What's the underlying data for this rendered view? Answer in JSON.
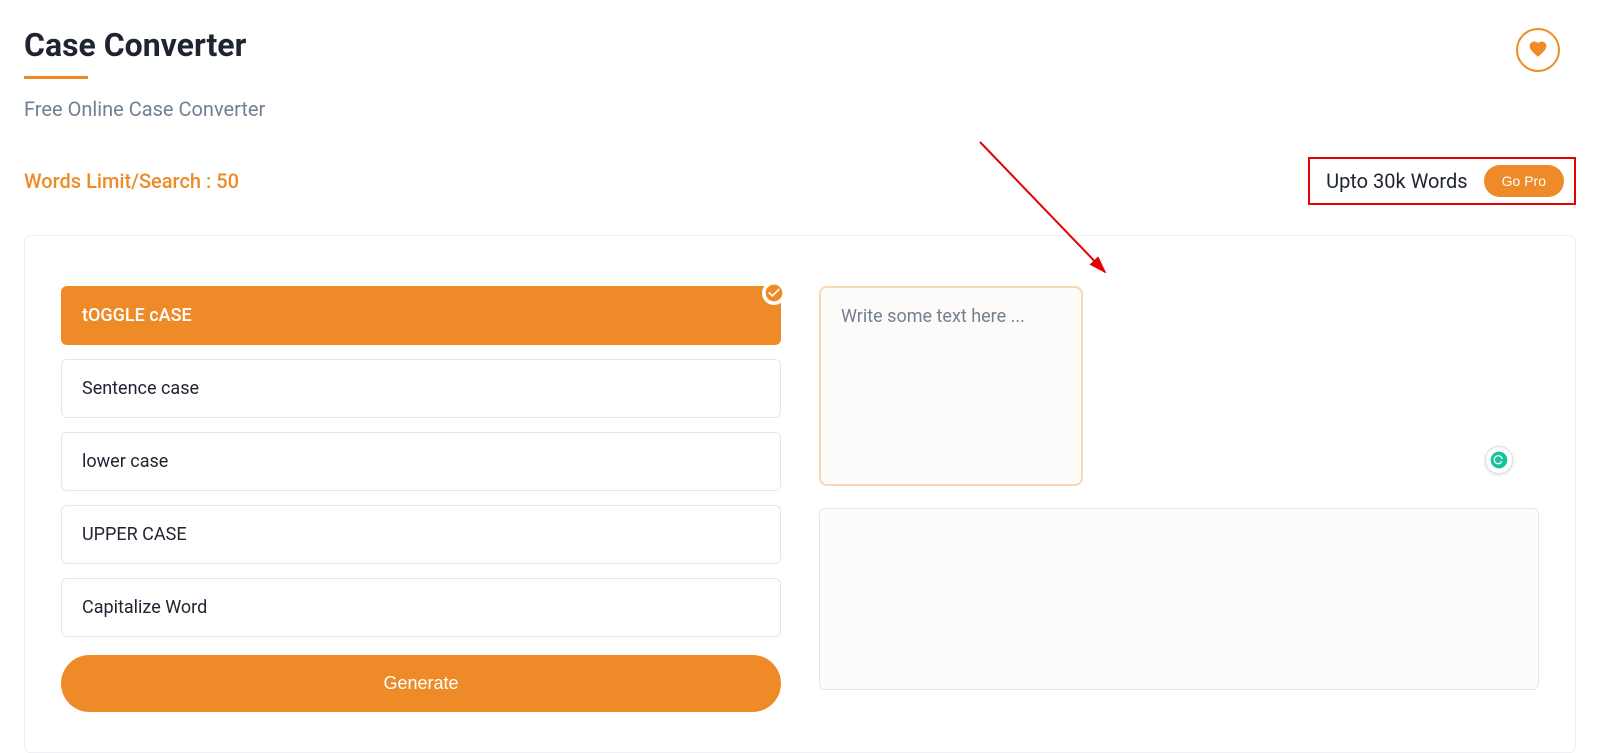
{
  "header": {
    "title": "Case Converter",
    "subtitle": "Free Online Case Converter"
  },
  "limit": {
    "label": "Words Limit/Search : 50"
  },
  "pro": {
    "text": "Upto 30k Words",
    "button": "Go Pro"
  },
  "options": [
    {
      "label": "tOGGLE cASE",
      "active": true
    },
    {
      "label": "Sentence case",
      "active": false
    },
    {
      "label": "lower case",
      "active": false
    },
    {
      "label": "UPPER CASE",
      "active": false
    },
    {
      "label": "Capitalize Word",
      "active": false
    }
  ],
  "generate": {
    "label": "Generate"
  },
  "input": {
    "placeholder": "Write some text here ..."
  },
  "colors": {
    "accent": "#ee8b28",
    "highlight_border": "#e60000"
  }
}
